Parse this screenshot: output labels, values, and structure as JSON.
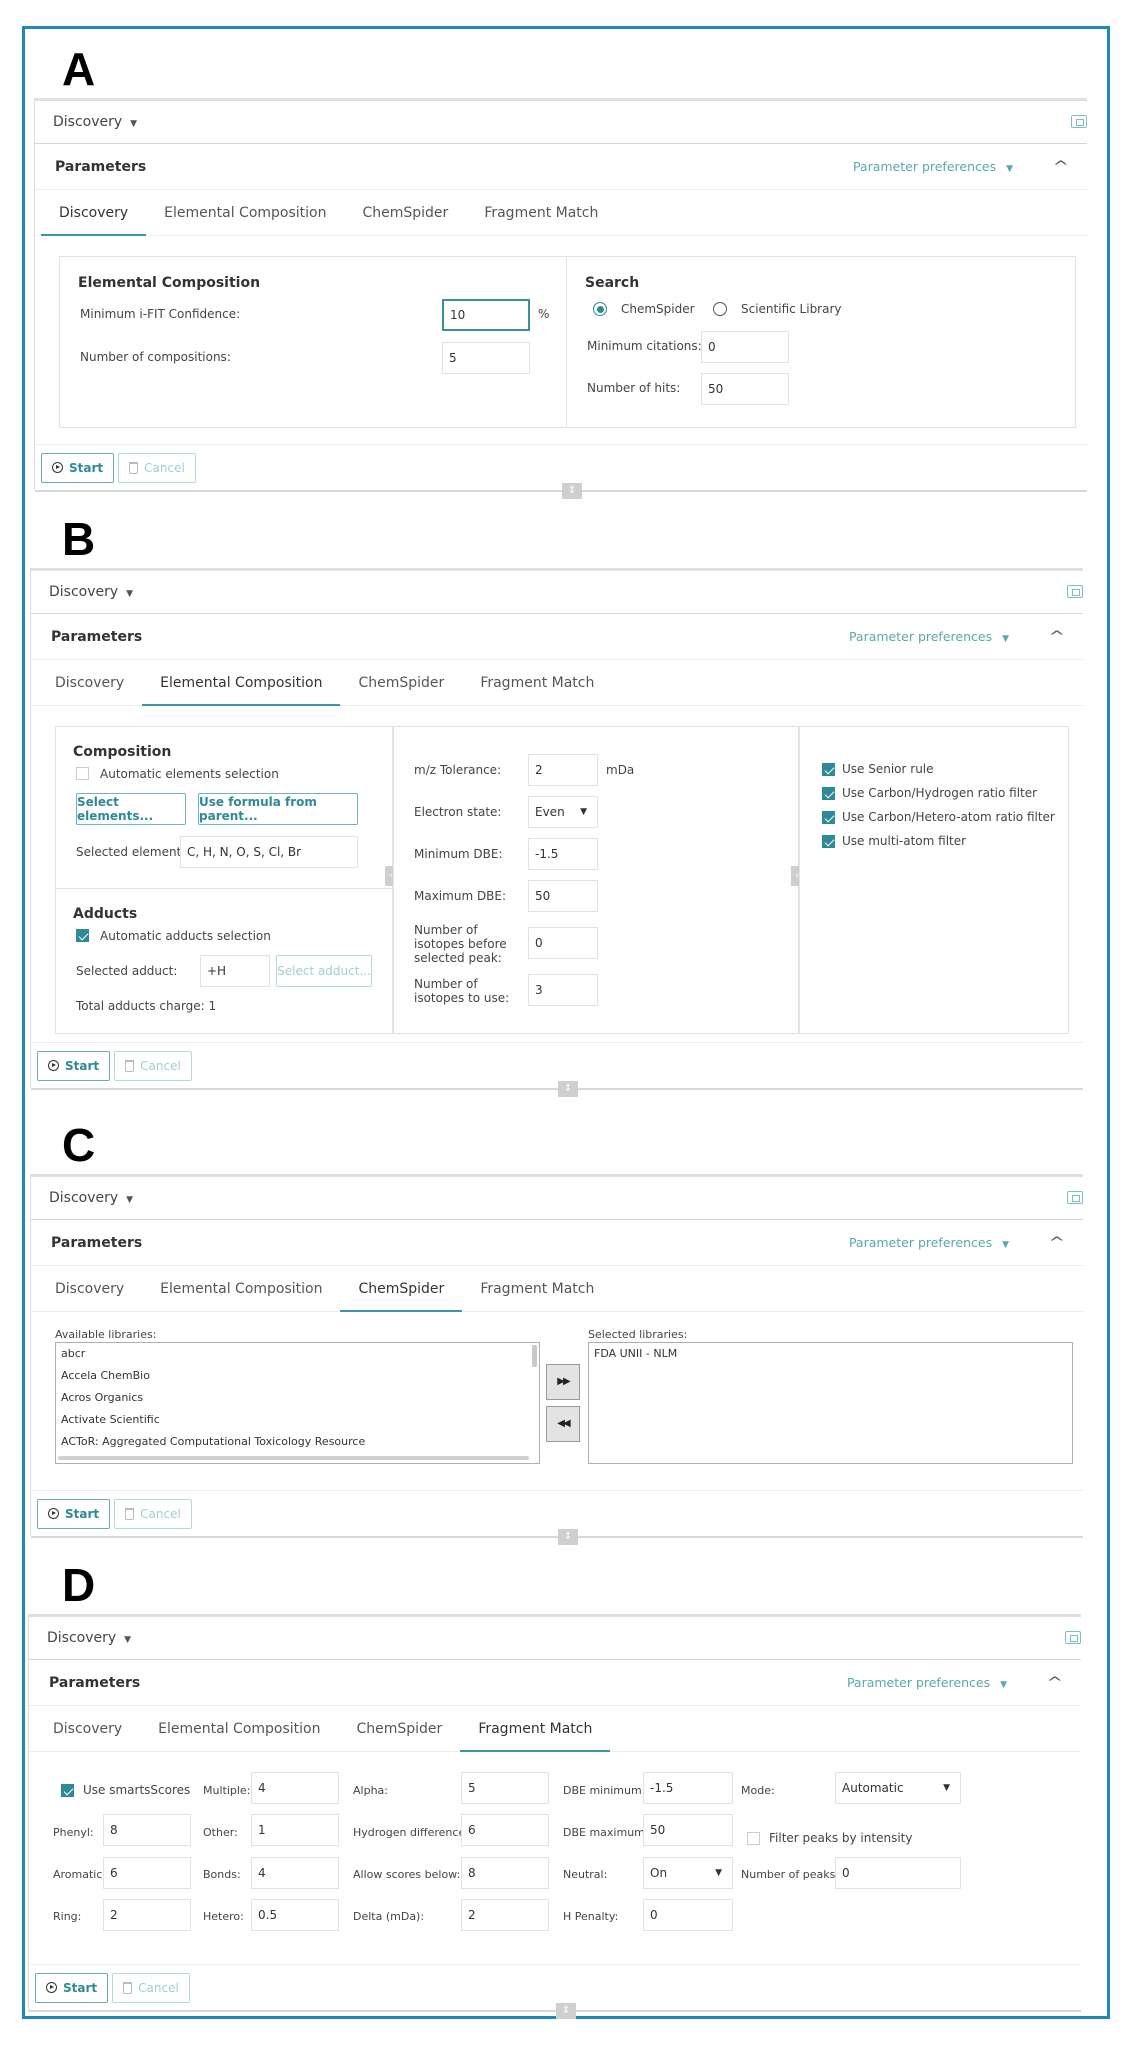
{
  "panels": [
    {
      "letter": "A",
      "header": {
        "dropdown": "Discovery",
        "parameters_title": "Parameters",
        "preferences": "Parameter preferences"
      },
      "tabs": [
        "Discovery",
        "Elemental Composition",
        "ChemSpider",
        "Fragment Match"
      ],
      "active_tab": "Discovery",
      "discovery": {
        "elemental_composition": {
          "title": "Elemental Composition",
          "min_ifit_label": "Minimum i-FIT Confidence:",
          "min_ifit_value": "10",
          "min_ifit_unit": "%",
          "num_compositions_label": "Number of compositions:",
          "num_compositions_value": "5"
        },
        "search": {
          "title": "Search",
          "radio_options": [
            "ChemSpider",
            "Scientific Library"
          ],
          "selected": "ChemSpider",
          "min_citations_label": "Minimum citations:",
          "min_citations_value": "0",
          "num_hits_label": "Number of hits:",
          "num_hits_value": "50"
        }
      },
      "actions": {
        "start": "Start",
        "cancel": "Cancel"
      }
    },
    {
      "letter": "B",
      "header": {
        "dropdown": "Discovery",
        "parameters_title": "Parameters",
        "preferences": "Parameter preferences"
      },
      "tabs": [
        "Discovery",
        "Elemental Composition",
        "ChemSpider",
        "Fragment Match"
      ],
      "active_tab": "Elemental Composition",
      "elemental": {
        "composition": {
          "title": "Composition",
          "auto_elements_label": "Automatic elements selection",
          "auto_elements_checked": false,
          "select_elements_btn": "Select elements...",
          "use_formula_btn": "Use formula from parent...",
          "selected_elements_label": "Selected elements:",
          "selected_elements_value": "C, H, N, O, S, Cl, Br"
        },
        "adducts": {
          "title": "Adducts",
          "auto_adducts_label": "Automatic adducts selection",
          "auto_adducts_checked": true,
          "selected_adduct_label": "Selected adduct:",
          "selected_adduct_value": "+H",
          "select_adduct_btn": "Select adduct...",
          "total_charge_label": "Total adducts charge: 1"
        },
        "tolerance": {
          "mz_label": "m/z Tolerance:",
          "mz_value": "2",
          "mz_unit": "mDa",
          "electron_label": "Electron state:",
          "electron_value": "Even",
          "min_dbe_label": "Minimum DBE:",
          "min_dbe_value": "-1.5",
          "max_dbe_label": "Maximum DBE:",
          "max_dbe_value": "50",
          "iso_before_label": "Number of isotopes before selected peak:",
          "iso_before_value": "0",
          "iso_use_label": "Number of isotopes to use:",
          "iso_use_value": "3"
        },
        "filters": [
          {
            "label": "Use Senior rule",
            "checked": true
          },
          {
            "label": "Use Carbon/Hydrogen ratio filter",
            "checked": true
          },
          {
            "label": "Use Carbon/Hetero-atom ratio filter",
            "checked": true
          },
          {
            "label": "Use multi-atom filter",
            "checked": true
          }
        ]
      },
      "actions": {
        "start": "Start",
        "cancel": "Cancel"
      }
    },
    {
      "letter": "C",
      "header": {
        "dropdown": "Discovery",
        "parameters_title": "Parameters",
        "preferences": "Parameter preferences"
      },
      "tabs": [
        "Discovery",
        "Elemental Composition",
        "ChemSpider",
        "Fragment Match"
      ],
      "active_tab": "ChemSpider",
      "chemspider": {
        "available_label": "Available libraries:",
        "available": [
          "abcr",
          "Accela ChemBio",
          "Acros Organics",
          "Activate Scientific",
          "ACToR: Aggregated Computational Toxicology Resource"
        ],
        "selected_label": "Selected libraries:",
        "selected": [
          "FDA UNII - NLM"
        ],
        "add_all_icon": "▶▶",
        "remove_all_icon": "◀◀"
      },
      "actions": {
        "start": "Start",
        "cancel": "Cancel"
      }
    },
    {
      "letter": "D",
      "header": {
        "dropdown": "Discovery",
        "parameters_title": "Parameters",
        "preferences": "Parameter preferences"
      },
      "tabs": [
        "Discovery",
        "Elemental Composition",
        "ChemSpider",
        "Fragment Match"
      ],
      "active_tab": "Fragment Match",
      "fragment": {
        "use_smarts_label": "Use smartsScores",
        "use_smarts_checked": true,
        "phenyl_label": "Phenyl:",
        "phenyl_value": "8",
        "aromatic_label": "Aromatic:",
        "aromatic_value": "6",
        "ring_label": "Ring:",
        "ring_value": "2",
        "multiple_label": "Multiple:",
        "multiple_value": "4",
        "other_label": "Other:",
        "other_value": "1",
        "bonds_label": "Bonds:",
        "bonds_value": "4",
        "hetero_label": "Hetero:",
        "hetero_value": "0.5",
        "alpha_label": "Alpha:",
        "alpha_value": "5",
        "hdiff_label": "Hydrogen difference:",
        "hdiff_value": "6",
        "allow_below_label": "Allow scores below:",
        "allow_below_value": "8",
        "delta_label": "Delta (mDa):",
        "delta_value": "2",
        "dbe_min_label": "DBE minimum:",
        "dbe_min_value": "-1.5",
        "dbe_max_label": "DBE maximum:",
        "dbe_max_value": "50",
        "neutral_label": "Neutral:",
        "neutral_value": "On",
        "hpenalty_label": "H Penalty:",
        "hpenalty_value": "0",
        "mode_label": "Mode:",
        "mode_value": "Automatic",
        "filter_peaks_label": "Filter peaks by intensity",
        "filter_peaks_checked": false,
        "num_peaks_label": "Number of peaks:",
        "num_peaks_value": "0"
      },
      "actions": {
        "start": "Start",
        "cancel": "Cancel"
      }
    }
  ],
  "colors": {
    "accent": "#2e8a94",
    "frame": "#1e88b8"
  }
}
